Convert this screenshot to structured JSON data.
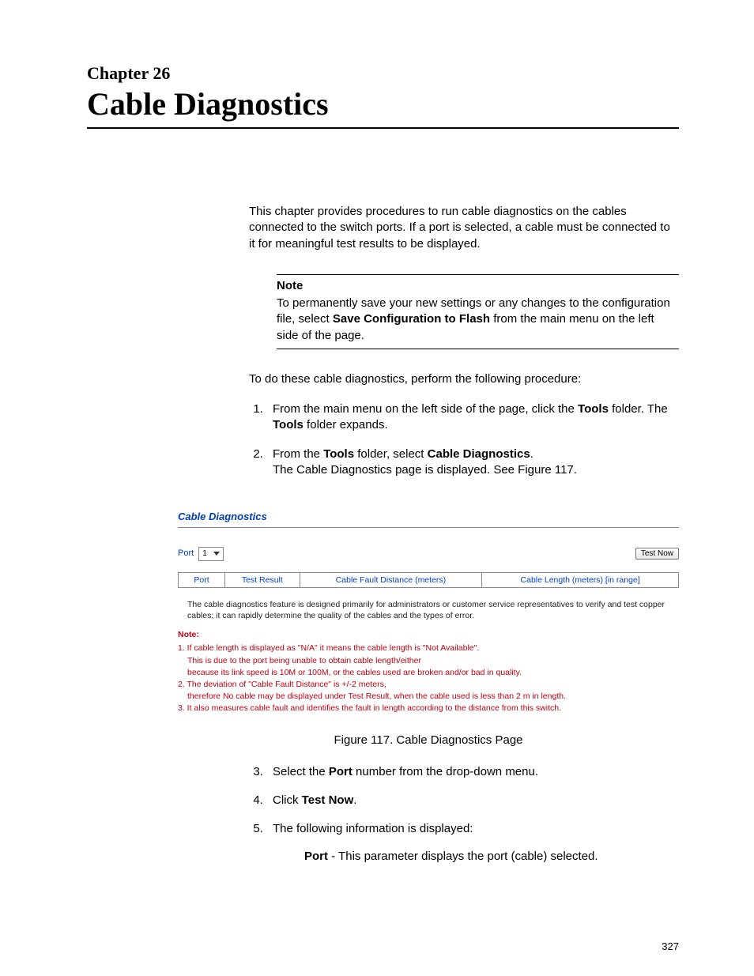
{
  "header": {
    "chapter_label": "Chapter 26",
    "title": "Cable Diagnostics"
  },
  "intro": "This chapter provides procedures to run cable diagnostics on the cables connected to the switch ports. If a port is selected, a cable must be connected to it for meaningful test results to be displayed.",
  "note": {
    "label": "Note",
    "before": "To permanently save your new settings or any changes to the configuration file, select ",
    "bold": "Save Configuration to Flash",
    "after": " from the main menu on the left side of the page."
  },
  "lead_in": "To do these cable diagnostics, perform the following procedure:",
  "steps": {
    "s1_a": "From the main menu on the left side of the page, click the ",
    "s1_bold": "Tools",
    "s1_b": " folder. The ",
    "s1_bold2": "Tools",
    "s1_c": " folder expands.",
    "s2_a": "From the ",
    "s2_bold": "Tools",
    "s2_b": " folder, select ",
    "s2_bold2": "Cable Diagnostics",
    "s2_c": ".",
    "s2_d": "The Cable Diagnostics page is displayed. See Figure 117.",
    "s3_a": "Select the ",
    "s3_bold": "Port",
    "s3_b": " number from the drop-down menu.",
    "s4_a": "Click ",
    "s4_bold": "Test Now",
    "s4_b": ".",
    "s5": "The following information is displayed:",
    "s5_sub_bold": "Port",
    "s5_sub_text": " - This parameter displays the port (cable) selected."
  },
  "figure": {
    "heading": "Cable Diagnostics",
    "port_label": "Port",
    "port_value": "1",
    "test_btn": "Test Now",
    "cols": {
      "port": "Port",
      "result": "Test Result",
      "fault": "Cable Fault Distance (meters)",
      "length": "Cable Length (meters) [in range]"
    },
    "desc": "The cable diagnostics feature is designed primarily for administrators or customer service representatives to verify and test copper cables; it can rapidly determine the quality of the cables and the types of error.",
    "notes": {
      "label": "Note:",
      "n1a": "1. If cable length is displayed as \"N/A\" it means the cable length is \"Not Available\".",
      "n1b": "This is due to the port being unable to obtain cable length/either",
      "n1c": "because its link speed is 10M or 100M, or the cables used are broken and/or bad in quality.",
      "n2a": "2. The deviation of \"Cable Fault Distance\" is +/-2 meters,",
      "n2b": "therefore No cable may be displayed under Test Result, when the cable used is less than 2 m in length.",
      "n3": "3. It also measures cable fault and identifies the fault in length according to the distance from this switch."
    },
    "caption": "Figure 117. Cable Diagnostics Page"
  },
  "page_number": "327"
}
